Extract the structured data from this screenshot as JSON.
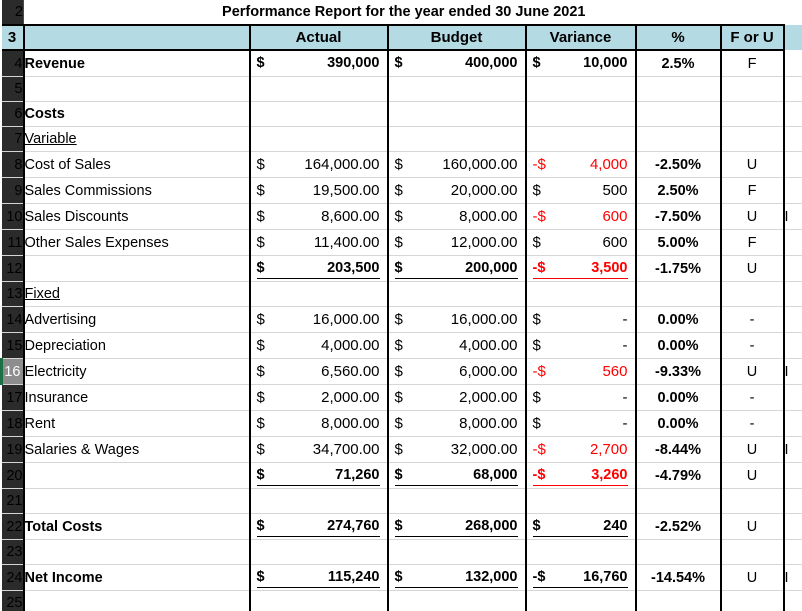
{
  "sheet": {
    "title": "Performance Report for the year ended 30 June 2021",
    "active_row": 16,
    "header_fill": "#b4dbe4",
    "negative_color": "#ff0000",
    "row_numbers": [
      "2",
      "3",
      "4",
      "5",
      "6",
      "7",
      "8",
      "9",
      "10",
      "11",
      "12",
      "13",
      "14",
      "15",
      "16",
      "17",
      "18",
      "19",
      "20",
      "21",
      "22",
      "23",
      "24",
      "25"
    ]
  },
  "columns": {
    "label": "",
    "actual": "Actual",
    "budget": "Budget",
    "variance": "Variance",
    "percent": "%",
    "for_u": "F or U"
  },
  "rows": [
    {
      "row": "4",
      "label": "Revenue",
      "label_style": "bold",
      "actual_sym": "$",
      "actual_amt": "390,000",
      "budget_sym": "$",
      "budget_amt": "400,000",
      "var_sym": "$",
      "var_amt": "10,000",
      "var_negative": false,
      "percent": "2.5%",
      "for_u": "F",
      "tail": ""
    },
    {
      "row": "5",
      "label": "",
      "label_style": "plain",
      "actual_sym": "",
      "actual_amt": "",
      "budget_sym": "",
      "budget_amt": "",
      "var_sym": "",
      "var_amt": "",
      "var_negative": false,
      "percent": "",
      "for_u": "",
      "tail": ""
    },
    {
      "row": "6",
      "label": "Costs",
      "label_style": "bold",
      "actual_sym": "",
      "actual_amt": "",
      "budget_sym": "",
      "budget_amt": "",
      "var_sym": "",
      "var_amt": "",
      "var_negative": false,
      "percent": "",
      "for_u": "",
      "tail": ""
    },
    {
      "row": "7",
      "label": "Variable",
      "label_style": "underline",
      "actual_sym": "",
      "actual_amt": "",
      "budget_sym": "",
      "budget_amt": "",
      "var_sym": "",
      "var_amt": "",
      "var_negative": false,
      "percent": "",
      "for_u": "",
      "tail": ""
    },
    {
      "row": "8",
      "label": "Cost of Sales",
      "label_style": "plain",
      "actual_sym": "$",
      "actual_amt": "164,000.00",
      "budget_sym": "$",
      "budget_amt": "160,000.00",
      "var_sym": "-$",
      "var_amt": "4,000",
      "var_negative": true,
      "percent": "-2.50%",
      "for_u": "U",
      "tail": ""
    },
    {
      "row": "9",
      "label": "Sales Commissions",
      "label_style": "plain",
      "actual_sym": "$",
      "actual_amt": "19,500.00",
      "budget_sym": "$",
      "budget_amt": "20,000.00",
      "var_sym": "$",
      "var_amt": "500",
      "var_negative": false,
      "percent": "2.50%",
      "for_u": "F",
      "tail": ""
    },
    {
      "row": "10",
      "label": "Sales Discounts",
      "label_style": "plain",
      "actual_sym": "$",
      "actual_amt": "8,600.00",
      "budget_sym": "$",
      "budget_amt": "8,000.00",
      "var_sym": "-$",
      "var_amt": "600",
      "var_negative": true,
      "percent": "-7.50%",
      "for_u": "U",
      "tail": "I"
    },
    {
      "row": "11",
      "label": "Other Sales Expenses",
      "label_style": "plain",
      "actual_sym": "$",
      "actual_amt": "11,400.00",
      "budget_sym": "$",
      "budget_amt": "12,000.00",
      "var_sym": "$",
      "var_amt": "600",
      "var_negative": false,
      "percent": "5.00%",
      "for_u": "F",
      "tail": ""
    },
    {
      "row": "12",
      "label": "",
      "label_style": "plain",
      "subtotal": true,
      "actual_sym": "$",
      "actual_amt": "203,500",
      "budget_sym": "$",
      "budget_amt": "200,000",
      "var_sym": "-$",
      "var_amt": "3,500",
      "var_negative": true,
      "percent": "-1.75%",
      "for_u": "U",
      "tail": ""
    },
    {
      "row": "13",
      "label": "Fixed",
      "label_style": "underline",
      "actual_sym": "",
      "actual_amt": "",
      "budget_sym": "",
      "budget_amt": "",
      "var_sym": "",
      "var_amt": "",
      "var_negative": false,
      "percent": "",
      "for_u": "",
      "tail": ""
    },
    {
      "row": "14",
      "label": "Advertising",
      "label_style": "plain",
      "actual_sym": "$",
      "actual_amt": "16,000.00",
      "budget_sym": "$",
      "budget_amt": "16,000.00",
      "var_sym": "$",
      "var_amt": "-",
      "var_negative": false,
      "percent": "0.00%",
      "for_u": "-",
      "tail": ""
    },
    {
      "row": "15",
      "label": "Depreciation",
      "label_style": "plain",
      "actual_sym": "$",
      "actual_amt": "4,000.00",
      "budget_sym": "$",
      "budget_amt": "4,000.00",
      "var_sym": "$",
      "var_amt": "-",
      "var_negative": false,
      "percent": "0.00%",
      "for_u": "-",
      "tail": ""
    },
    {
      "row": "16",
      "label": "Electricity",
      "label_style": "plain",
      "actual_sym": "$",
      "actual_amt": "6,560.00",
      "budget_sym": "$",
      "budget_amt": "6,000.00",
      "var_sym": "-$",
      "var_amt": "560",
      "var_negative": true,
      "percent": "-9.33%",
      "for_u": "U",
      "tail": "I"
    },
    {
      "row": "17",
      "label": "Insurance",
      "label_style": "plain",
      "actual_sym": "$",
      "actual_amt": "2,000.00",
      "budget_sym": "$",
      "budget_amt": "2,000.00",
      "var_sym": "$",
      "var_amt": "-",
      "var_negative": false,
      "percent": "0.00%",
      "for_u": "-",
      "tail": ""
    },
    {
      "row": "18",
      "label": "Rent",
      "label_style": "plain",
      "actual_sym": "$",
      "actual_amt": "8,000.00",
      "budget_sym": "$",
      "budget_amt": "8,000.00",
      "var_sym": "$",
      "var_amt": "-",
      "var_negative": false,
      "percent": "0.00%",
      "for_u": "-",
      "tail": ""
    },
    {
      "row": "19",
      "label": "Salaries & Wages",
      "label_style": "plain",
      "actual_sym": "$",
      "actual_amt": "34,700.00",
      "budget_sym": "$",
      "budget_amt": "32,000.00",
      "var_sym": "-$",
      "var_amt": "2,700",
      "var_negative": true,
      "percent": "-8.44%",
      "for_u": "U",
      "tail": "I"
    },
    {
      "row": "20",
      "label": "",
      "label_style": "plain",
      "subtotal": true,
      "actual_sym": "$",
      "actual_amt": "71,260",
      "budget_sym": "$",
      "budget_amt": "68,000",
      "var_sym": "-$",
      "var_amt": "3,260",
      "var_negative": true,
      "percent": "-4.79%",
      "for_u": "U",
      "tail": ""
    },
    {
      "row": "21",
      "label": "",
      "label_style": "plain",
      "actual_sym": "",
      "actual_amt": "",
      "budget_sym": "",
      "budget_amt": "",
      "var_sym": "",
      "var_amt": "",
      "var_negative": false,
      "percent": "",
      "for_u": "",
      "tail": ""
    },
    {
      "row": "22",
      "label": "Total Costs",
      "label_style": "bold",
      "subtotal": true,
      "actual_sym": "$",
      "actual_amt": "274,760",
      "budget_sym": "$",
      "budget_amt": "268,000",
      "var_sym": "$",
      "var_amt": "240",
      "var_negative": false,
      "percent": "-2.52%",
      "for_u": "U",
      "tail": ""
    },
    {
      "row": "23",
      "label": "",
      "label_style": "plain",
      "actual_sym": "",
      "actual_amt": "",
      "budget_sym": "",
      "budget_amt": "",
      "var_sym": "",
      "var_amt": "",
      "var_negative": false,
      "percent": "",
      "for_u": "",
      "tail": ""
    },
    {
      "row": "24",
      "label": "Net Income",
      "label_style": "bold",
      "total": true,
      "actual_sym": "$",
      "actual_amt": "115,240",
      "budget_sym": "$",
      "budget_amt": "132,000",
      "var_sym": "-$",
      "var_amt": "16,760",
      "var_negative": false,
      "percent": "-14.54%",
      "for_u": "U",
      "tail": "I"
    },
    {
      "row": "25",
      "label": "",
      "label_style": "plain",
      "actual_sym": "",
      "actual_amt": "",
      "budget_sym": "",
      "budget_amt": "",
      "var_sym": "",
      "var_amt": "",
      "var_negative": false,
      "percent": "",
      "for_u": "",
      "tail": ""
    }
  ]
}
